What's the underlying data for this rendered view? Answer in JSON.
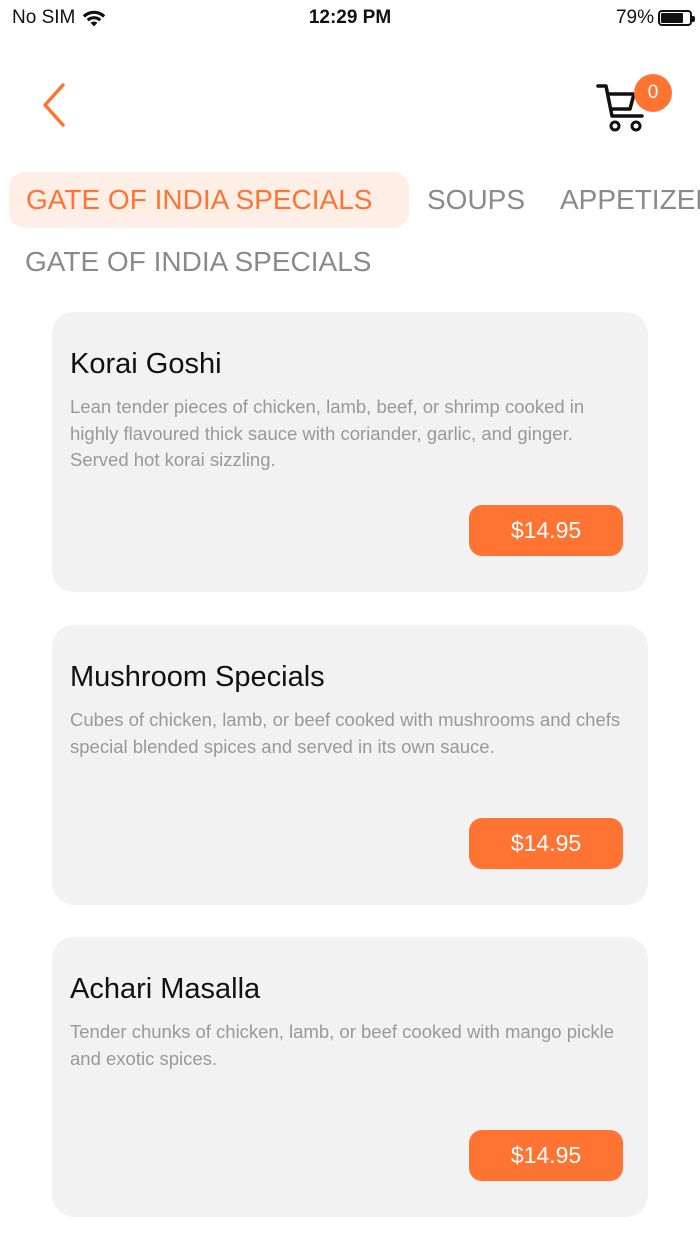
{
  "status_bar": {
    "carrier": "No SIM",
    "time": "12:29 PM",
    "battery": "79%",
    "battery_level": 0.79
  },
  "header": {
    "cart_count": "0"
  },
  "tabs": [
    {
      "label": "GATE OF INDIA SPECIALS",
      "active": true
    },
    {
      "label": "SOUPS",
      "active": false
    },
    {
      "label": "APPETIZERS",
      "active": false
    }
  ],
  "section": {
    "title": "GATE OF INDIA SPECIALS"
  },
  "items": [
    {
      "name": "Korai Goshi",
      "description": "Lean tender pieces of chicken, lamb, beef, or shrimp cooked in highly flavoured thick sauce with coriander, garlic, and ginger. Served hot korai sizzling.",
      "price": "$14.95"
    },
    {
      "name": "Mushroom Specials",
      "description": "Cubes of chicken, lamb, or beef cooked with mushrooms and chefs special blended spices and served in its own sauce.",
      "price": "$14.95"
    },
    {
      "name": "Achari Masalla",
      "description": "Tender chunks of chicken, lamb, or beef cooked with mango pickle and exotic spices.",
      "price": "$14.95"
    }
  ],
  "colors": {
    "accent": "#FF7433",
    "active_tab_bg": "#FDEEE6",
    "card_bg": "#F2F2F2",
    "muted_text": "#8a8a8a"
  },
  "icons": {
    "back": "chevron-left-icon",
    "cart": "cart-icon",
    "wifi": "wifi-icon",
    "battery": "battery-icon"
  }
}
